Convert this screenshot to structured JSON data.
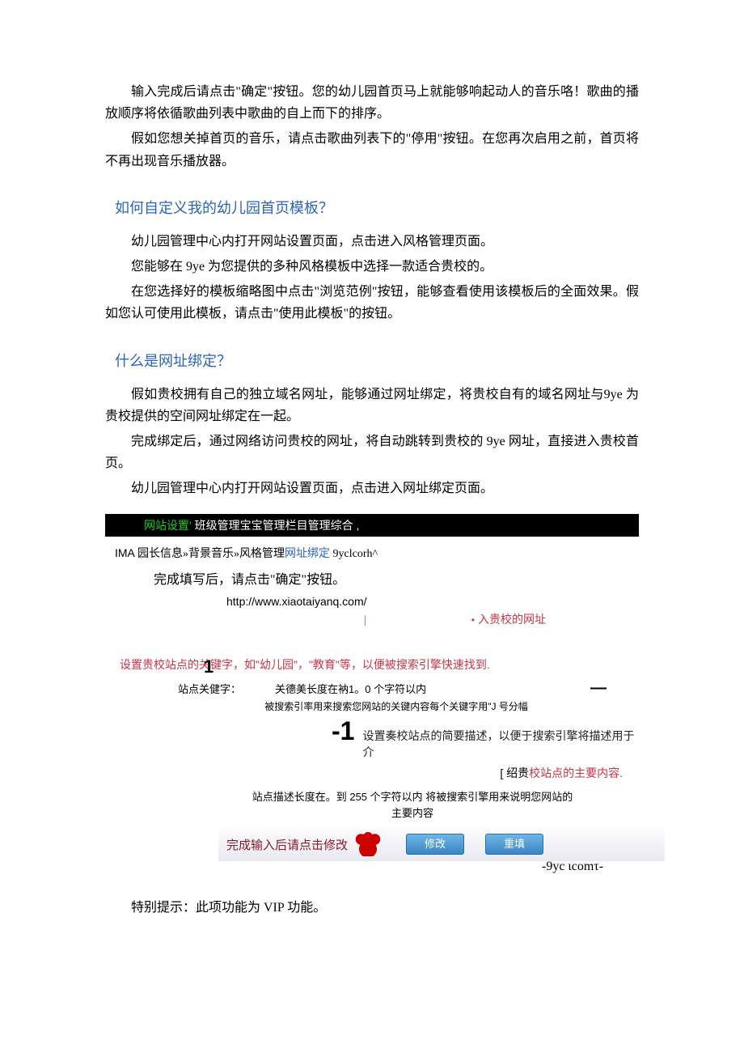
{
  "intro": {
    "p1": "输入完成后请点击\"确定\"按钮。您的幼儿园首页马上就能够响起动人的音乐咯！歌曲的播放顺序将依循歌曲列表中歌曲的自上而下的排序。",
    "p2": "假如您想关掉首页的音乐，请点击歌曲列表下的\"停用\"按钮。在您再次启用之前，首页将不再出现音乐播放器。"
  },
  "section_template": {
    "heading": "如何自定义我的幼儿园首页模板？",
    "p1": "幼儿园管理中心内打开网站设置页面，点击进入风格管理页面。",
    "p2": "您能够在 9ye 为您提供的多种风格模板中选择一款适合贵校的。",
    "p3": "在您选择好的模板缩略图中点击\"浏览范例\"按钮，能够查看使用该模板后的全面效果。假如您认可使用此模板，请点击\"使用此模板\"的按钮。"
  },
  "section_binding": {
    "heading": "什么是网址绑定？",
    "p1": "假如贵校拥有自己的独立域名网址，能够通过网址绑定，将贵校自有的域名网址与9ye 为贵校提供的空间网址绑定在一起。",
    "p2": "完成绑定后，通过网络访问贵校的网址，将自动跳转到贵校的 9ye 网址，直接进入贵校首页。",
    "p3": "幼儿园管理中心内打开网站设置页面，点击进入网址绑定页面。"
  },
  "nav": {
    "item1": "网站设置'",
    "rest": " 班级管理宝宝管理栏目管理综合 ,"
  },
  "subnav": {
    "prefix": "IMA ",
    "items_plain": "园长信息»背景音乐»风格管理",
    "current": "网址绑定",
    "tail": " 9yclcorh^"
  },
  "form": {
    "after_fill": "完成填写后，请点击\"确定\"按钮。",
    "url": "http://www.xiaotaiyanq.com/",
    "pipe": "|",
    "tick": "•",
    "input_hint": "入贵校的网址",
    "marker1": "1",
    "keyword_tip": "设置贵校站点的关键字，如\"幼儿园\"，\"教育\"等，以便被搜索引擎快速找到.",
    "kw_label": "站点关健字：",
    "kw_limit": "关德美长度在衲1。0 个字符以内",
    "dash": "—",
    "kw_hint": "被搜索引率用来搜索您网站的关键内容每个关键字用\"J 号分幅",
    "neg1": "-1",
    "desc_tip": "设置奏校站点的简要描述，以便于搜索引擎将描述用于介",
    "bracket_black": "[ 绍贵",
    "bracket_red": "校站点的主要内容.",
    "desc_limit": "站点描述长度在。到 255 个字符以内 将被搜索引擎用来说明您网站的主要内容",
    "lead": "完成输入后请点击修改",
    "btn_modify": "修改",
    "btn_reset": "重填",
    "trail": "-9yc ιcomτ-"
  },
  "footer": {
    "note": "特别提示：此项功能为 VIP 功能。"
  }
}
